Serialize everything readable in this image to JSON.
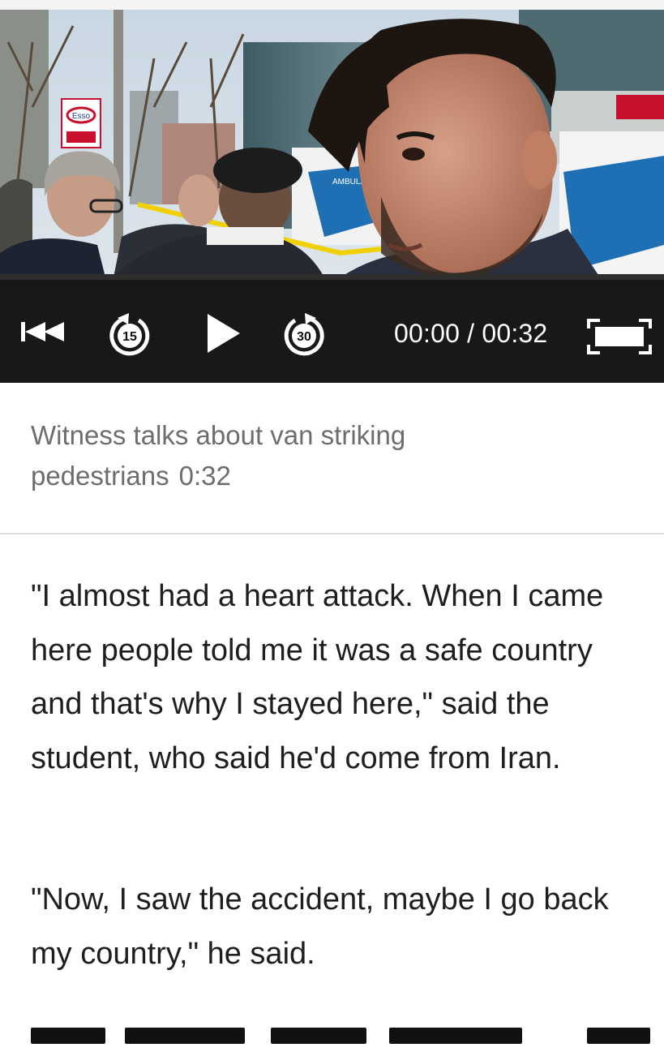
{
  "video": {
    "time_display": "00:00 / 00:32",
    "progress": 0,
    "controls": {
      "previous_icon": "skip-previous-icon",
      "rewind_icon": "rewind-15-icon",
      "rewind_label": "15",
      "play_icon": "play-icon",
      "forward_icon": "forward-30-icon",
      "forward_label": "30",
      "fullscreen_icon": "fullscreen-icon"
    },
    "scene_signs": {
      "gas_station": "Esso",
      "ambulance": "AMBULANCE"
    }
  },
  "caption": {
    "title": "Witness talks about van striking pedestrians",
    "duration": "0:32"
  },
  "article": {
    "paragraphs": [
      "\"I almost had a heart attack. When I came here people told me it was a safe country and that's why I stayed here,\" said the student, who said he'd come from Iran.",
      "\"Now, I saw the accident, maybe I go back my country,\" he said."
    ]
  },
  "colors": {
    "controls_background": "#080808",
    "caption_text": "#6d6d6d",
    "body_text": "#1e1e1e",
    "divider": "#dedede"
  }
}
